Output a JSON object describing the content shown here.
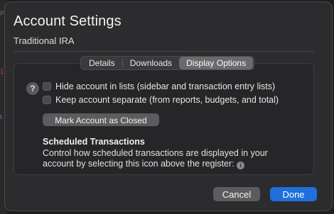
{
  "window": {
    "title": "Account Settings",
    "subtitle": "Traditional IRA"
  },
  "tabs": [
    {
      "label": "Details",
      "active": false
    },
    {
      "label": "Downloads",
      "active": false
    },
    {
      "label": "Display Options",
      "active": true
    }
  ],
  "options": {
    "hide_account_label": "Hide account in lists (sidebar and transaction entry lists)",
    "keep_separate_label": "Keep account separate (from reports, budgets, and total)",
    "mark_closed_label": "Mark Account as Closed"
  },
  "scheduled": {
    "heading": "Scheduled Transactions",
    "description": "Control how scheduled transactions are displayed in your account by selecting this icon above the register:"
  },
  "footer": {
    "cancel_label": "Cancel",
    "done_label": "Done"
  },
  "colors": {
    "accent": "#1f6fdc",
    "background": "#2c2c2e"
  }
}
